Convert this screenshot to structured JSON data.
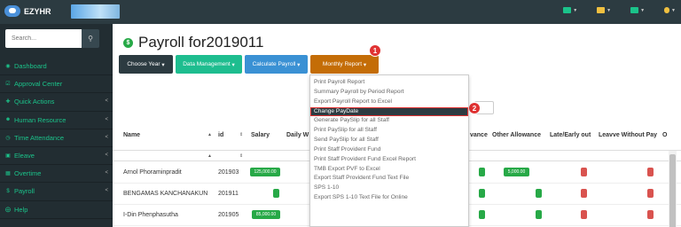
{
  "app": {
    "name": "EZYHR"
  },
  "top_icons": [
    {
      "name": "mail-icon",
      "color": "#1bc38a"
    },
    {
      "name": "calendar-icon",
      "color": "#f0c040"
    },
    {
      "name": "monitor-icon",
      "color": "#1bc38a"
    },
    {
      "name": "user-icon",
      "color": "#f0c040"
    }
  ],
  "sidebar": {
    "search_placeholder": "Search...",
    "items": [
      {
        "label": "Dashboard",
        "icon": "dashboard-icon",
        "has_chevron": false
      },
      {
        "label": "Approval Center",
        "icon": "check-icon",
        "has_chevron": false
      },
      {
        "label": "Quick Actions",
        "icon": "plus-icon",
        "has_chevron": true
      },
      {
        "label": "Human Resource",
        "icon": "users-icon",
        "has_chevron": true
      },
      {
        "label": "Time Attendance",
        "icon": "clock-icon",
        "has_chevron": true
      },
      {
        "label": "Eleave",
        "icon": "calendar-icon",
        "has_chevron": true
      },
      {
        "label": "Overtime",
        "icon": "overtime-icon",
        "has_chevron": true
      },
      {
        "label": "Payroll",
        "icon": "dollar-icon",
        "has_chevron": true
      },
      {
        "label": "Help",
        "icon": "help-icon",
        "has_chevron": false
      }
    ]
  },
  "page": {
    "title": "Payroll for2019011"
  },
  "toolbar": {
    "choose_year": "Choose Year",
    "data_management": "Data Management",
    "calculate_payroll": "Calculate Payroll",
    "monthly_report": "Monthly Report"
  },
  "markers": {
    "m1": "1",
    "m2": "2"
  },
  "dropdown": {
    "items": [
      "Print Payroll Report",
      "Summary Payroll by Period Report",
      "Export Payroll Report to Excel",
      "Change PayDate",
      "Generate PaySlip for all Staff",
      "Print PaySlip for all Staff",
      "Send PaySlip for all Staff",
      "Print Staff Provident Fund",
      "Print Staff Provident Fund Excel Report",
      "TMB Export PVF to Excel",
      "Export Staff Provident Fund Text File",
      "SPS 1-10",
      "Export SPS 1-10 Text File for Online"
    ],
    "active_index": 3
  },
  "table": {
    "headers": {
      "name": "Name",
      "id": "id",
      "salary": "Salary",
      "daily": "Daily W",
      "allowance": "vance",
      "other_allowance": "Other Allowance",
      "late": "Late/Early out",
      "leave": "Leavve Without Pay",
      "extra": "O"
    },
    "rows": [
      {
        "name": "Arnol Phoraminpradit",
        "id": "201903",
        "salary": "125,000.00",
        "other_allowance": "5,000.00"
      },
      {
        "name": "BENGAMAS KANCHANAKUN",
        "id": "201911",
        "salary": "",
        "other_allowance": ""
      },
      {
        "name": "I-Din Phenphasutha",
        "id": "201905",
        "salary": "85,000.00",
        "other_allowance": ""
      }
    ]
  }
}
